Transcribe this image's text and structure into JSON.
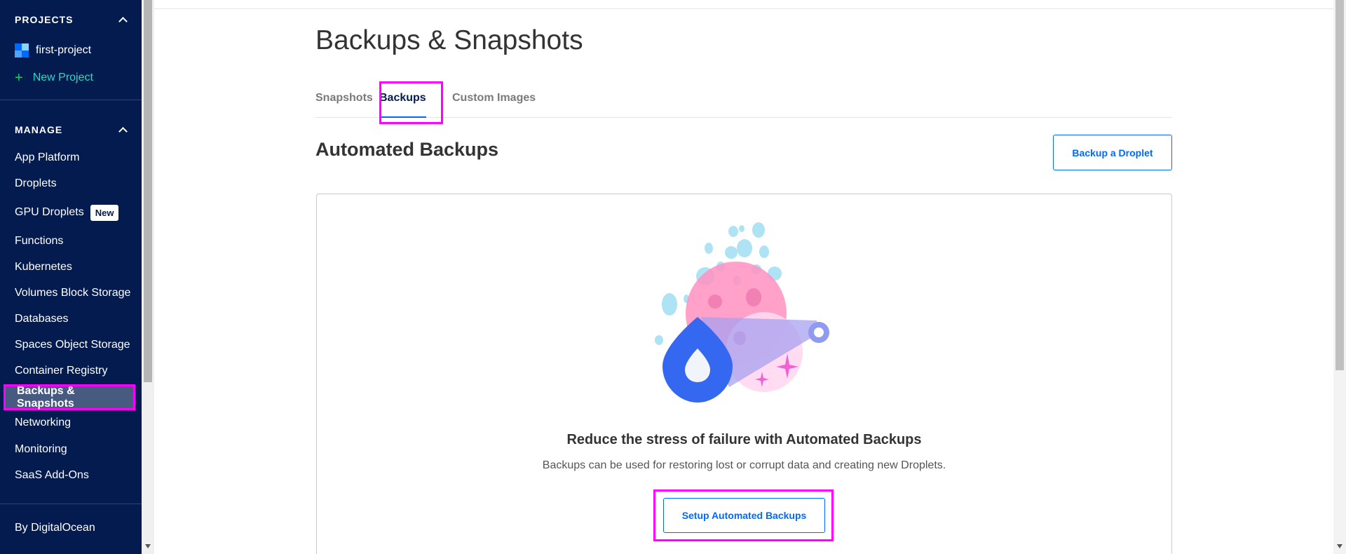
{
  "sidebar": {
    "projects_title": "PROJECTS",
    "project_name": "first-project",
    "new_project": "New Project",
    "manage_title": "MANAGE",
    "items": [
      {
        "label": "App Platform"
      },
      {
        "label": "Droplets"
      },
      {
        "label": "GPU Droplets",
        "badge": "New"
      },
      {
        "label": "Functions"
      },
      {
        "label": "Kubernetes"
      },
      {
        "label": "Volumes Block Storage"
      },
      {
        "label": "Databases"
      },
      {
        "label": "Spaces Object Storage"
      },
      {
        "label": "Container Registry"
      },
      {
        "label": "Backups & Snapshots",
        "active": true
      },
      {
        "label": "Networking"
      },
      {
        "label": "Monitoring"
      },
      {
        "label": "SaaS Add-Ons"
      }
    ],
    "footer": "By DigitalOcean"
  },
  "main": {
    "title": "Backups & Snapshots",
    "tabs": [
      {
        "label": "Snapshots"
      },
      {
        "label": "Backups",
        "active": true
      },
      {
        "label": "Custom Images"
      }
    ],
    "section_title": "Automated Backups",
    "backup_button": "Backup a Droplet",
    "empty_state": {
      "heading": "Reduce the stress of failure with Automated Backups",
      "description": "Backups can be used for restoring lost or corrupt data and creating new Droplets.",
      "button": "Setup Automated Backups",
      "illustration": "droplet-backup-illustration"
    }
  },
  "colors": {
    "sidebar_bg": "#031b4e",
    "accent": "#0069ff",
    "new_project": "#2fd5c5",
    "highlight": "#ff00ff"
  }
}
